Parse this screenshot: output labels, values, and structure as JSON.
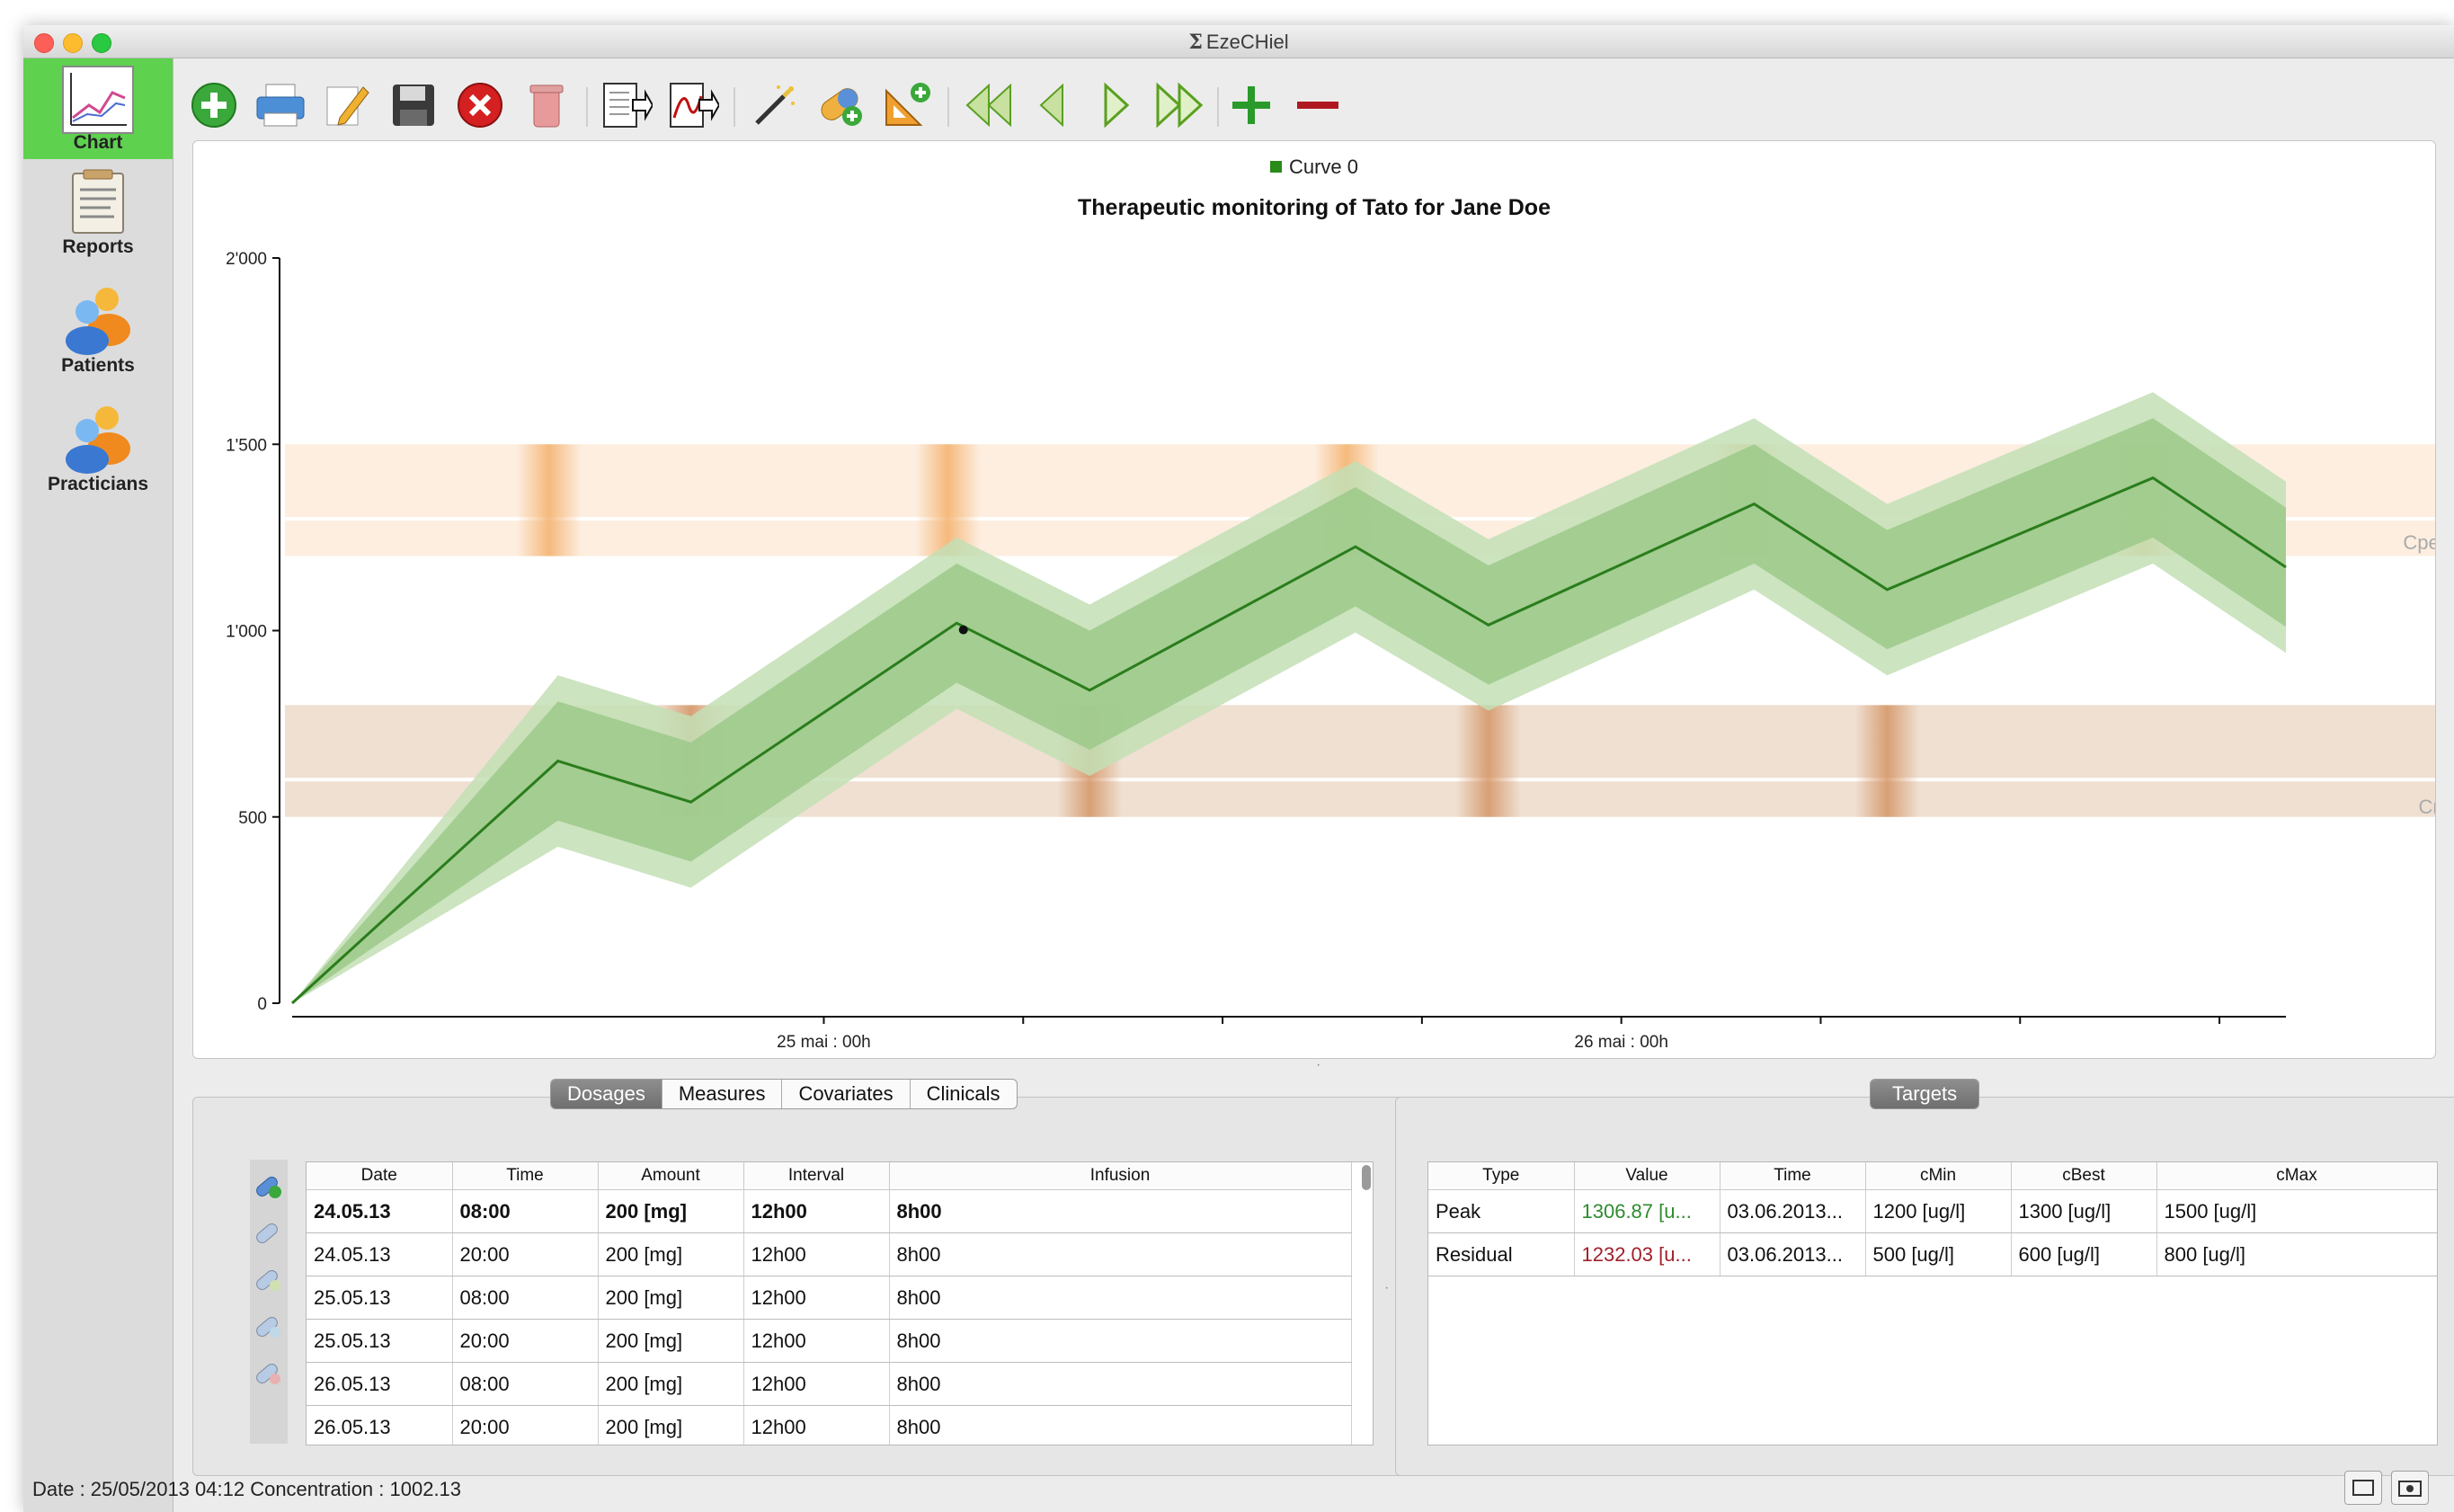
{
  "window": {
    "title": "EzeCHiel"
  },
  "nav": {
    "items": [
      {
        "label": "Chart",
        "icon": "chart-icon",
        "active": true
      },
      {
        "label": "Reports",
        "icon": "report-icon",
        "active": false
      },
      {
        "label": "Patients",
        "icon": "patients-icon",
        "active": false
      },
      {
        "label": "Practicians",
        "icon": "practicians-icon",
        "active": false
      }
    ]
  },
  "toolbar": {
    "buttons": [
      "add-icon",
      "print-icon",
      "edit-icon",
      "save-icon",
      "cancel-icon",
      "delete-icon",
      "export-data-icon",
      "export-curve-icon",
      "wand-icon",
      "add-drug-icon",
      "add-measure-icon",
      "first-icon",
      "previous-icon",
      "next-icon",
      "last-icon",
      "zoom-in-icon",
      "zoom-out-icon"
    ]
  },
  "chart": {
    "legend": "Curve 0",
    "title": "Therapeutic monitoring of Tato for Jane Doe",
    "target_labels": {
      "peak": "Cpeak",
      "residual": "Cres"
    },
    "colors": {
      "curve": "#2a7d1c",
      "band_inner": "#9cc98a",
      "band_outer": "#c3dfb5",
      "peak_band": "#fdeee0",
      "residual_band": "#efe0d2",
      "peak_marker": "#f2a85b",
      "residual_marker": "#d08a55"
    }
  },
  "chart_data": {
    "type": "line",
    "title": "Therapeutic monitoring of Tato for Jane Doe",
    "xlabel": "",
    "ylabel": "",
    "x_tick_labels": [
      "25 mai : 00h",
      "26 mai : 00h"
    ],
    "y_tick_labels": [
      "0",
      "500",
      "1'000",
      "1'500",
      "2'000"
    ],
    "ylim": [
      0,
      2000
    ],
    "xlim_hours_from_24may_08h": [
      0,
      60
    ],
    "series": [
      {
        "name": "Curve 0",
        "x_hours_from_24may_08h": [
          0,
          8,
          12,
          20,
          24,
          32,
          36,
          44,
          48,
          56,
          60
        ],
        "values": [
          0,
          650,
          540,
          1020,
          840,
          1225,
          1015,
          1340,
          1110,
          1410,
          1170
        ]
      }
    ],
    "targets": [
      {
        "name": "Cpeak",
        "min": 1200,
        "best": 1300,
        "max": 1500
      },
      {
        "name": "Cres",
        "min": 500,
        "best": 600,
        "max": 800
      }
    ],
    "selected_point": {
      "x_hours_from_24may_08h": 20.2,
      "y": 1002.13
    },
    "grid": false,
    "legend_position": "top"
  },
  "dosage_tabs": [
    "Dosages",
    "Measures",
    "Covariates",
    "Clinicals"
  ],
  "dosages": {
    "columns": [
      "Date",
      "Time",
      "Amount",
      "Interval",
      "Infusion"
    ],
    "rows": [
      [
        "24.05.13",
        "08:00",
        "200 [mg]",
        "12h00",
        "8h00"
      ],
      [
        "24.05.13",
        "20:00",
        "200 [mg]",
        "12h00",
        "8h00"
      ],
      [
        "25.05.13",
        "08:00",
        "200 [mg]",
        "12h00",
        "8h00"
      ],
      [
        "25.05.13",
        "20:00",
        "200 [mg]",
        "12h00",
        "8h00"
      ],
      [
        "26.05.13",
        "08:00",
        "200 [mg]",
        "12h00",
        "8h00"
      ],
      [
        "26.05.13",
        "20:00",
        "200 [mg]",
        "12h00",
        "8h00"
      ]
    ]
  },
  "targets_tab": "Targets",
  "targets": {
    "columns": [
      "Type",
      "Value",
      "Time",
      "cMin",
      "cBest",
      "cMax"
    ],
    "rows": [
      [
        "Peak",
        "1306.87 [u...",
        "03.06.2013...",
        "1200 [ug/l]",
        "1300 [ug/l]",
        "1500 [ug/l]"
      ],
      [
        "Residual",
        "1232.03 [u...",
        "03.06.2013...",
        "500 [ug/l]",
        "600 [ug/l]",
        "800 [ug/l]"
      ]
    ],
    "value_colors": [
      "#2e8b2e",
      "#a0202a"
    ]
  },
  "status": {
    "text": "Date : 25/05/2013 04:12 Concentration : 1002.13"
  }
}
